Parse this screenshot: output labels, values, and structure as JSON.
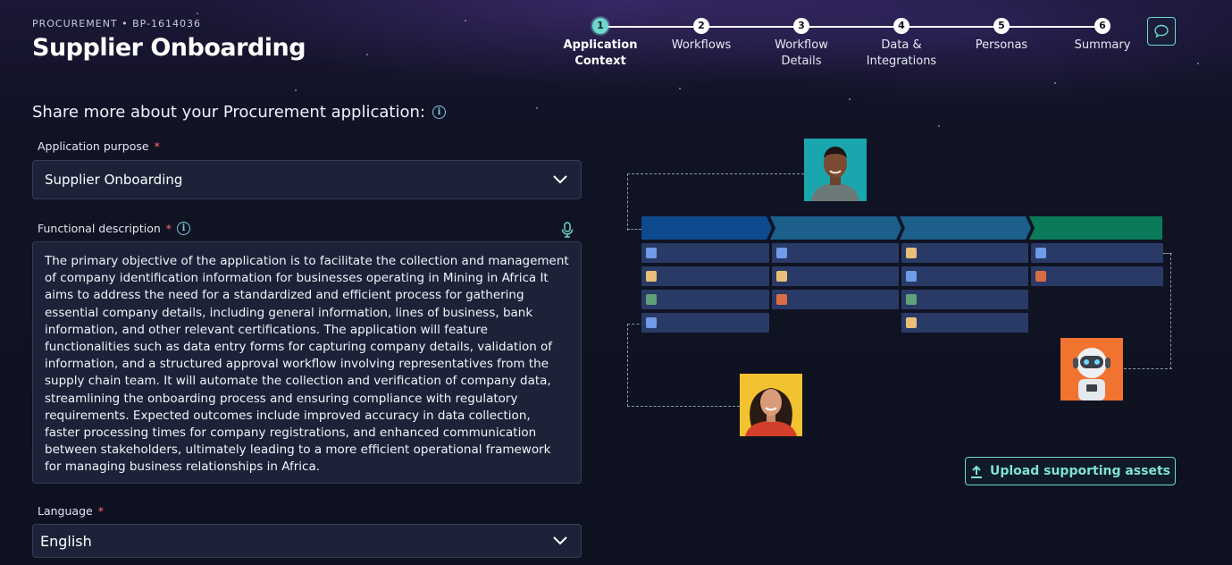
{
  "header": {
    "eyebrow": "PROCUREMENT • BP-1614036",
    "title": "Supplier Onboarding"
  },
  "stepper": [
    {
      "num": "1",
      "label": "Application\nContext",
      "active": true
    },
    {
      "num": "2",
      "label": "Workflows",
      "active": false
    },
    {
      "num": "3",
      "label": "Workflow\nDetails",
      "active": false
    },
    {
      "num": "4",
      "label": "Data &\nIntegrations",
      "active": false
    },
    {
      "num": "5",
      "label": "Personas",
      "active": false
    },
    {
      "num": "6",
      "label": "Summary",
      "active": false
    }
  ],
  "form": {
    "heading": "Share more about your Procurement application:",
    "purpose_label": "Application purpose",
    "purpose_value": "Supplier Onboarding",
    "description_label": "Functional description",
    "description_value": "The primary objective of the application is to facilitate the collection and management of company identification information for businesses operating in Mining in Africa It aims to address the need for a standardized and efficient process for gathering essential company details, including general information, lines of business, bank information, and other relevant certifications. The application will feature functionalities such as data entry forms for capturing company details, validation of information, and a structured approval workflow involving representatives from the supply chain team. It will automate the collection and verification of company data, streamlining the onboarding process and ensuring compliance with regulatory requirements. Expected outcomes include improved accuracy in data collection, faster processing times for company registrations, and enhanced communication between stakeholders, ultimately leading to a more efficient operational framework for managing business relationships in Africa.",
    "language_label": "Language",
    "language_value": "English",
    "required_mark": "*"
  },
  "upload_button": "Upload supporting assets",
  "colors": {
    "accent": "#6fd6cc",
    "header_blue": "#0e4a8e",
    "header_teal": "#1b5f8a",
    "header_green": "#0b7a5a",
    "chip_blue": "#6f9be8",
    "chip_yellow": "#e8c07a",
    "chip_green": "#5fa07a",
    "chip_orange": "#d96d45"
  },
  "icons": [
    "chat-icon",
    "info-icon",
    "chevron-down-icon",
    "microphone-icon",
    "upload-icon"
  ]
}
